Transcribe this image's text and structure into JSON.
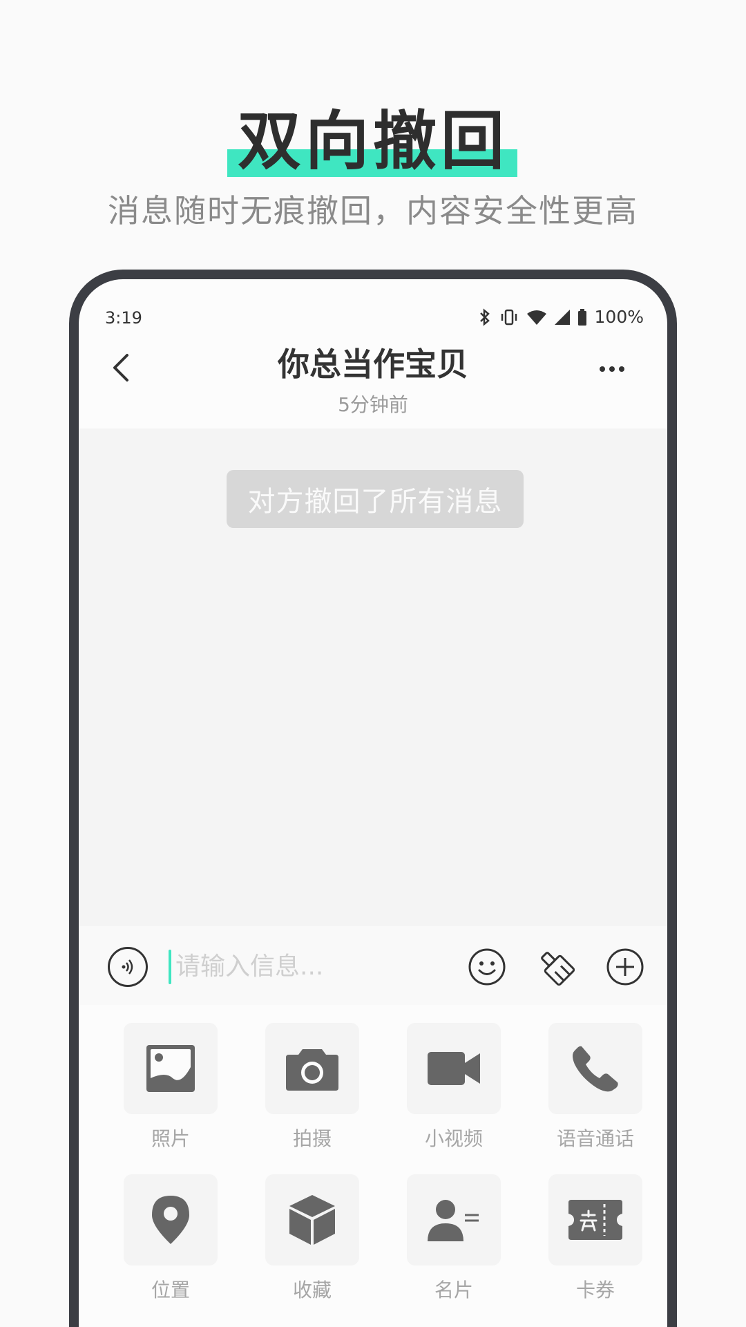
{
  "hero": {
    "title": "双向撤回",
    "subtitle": "消息随时无痕撤回，内容安全性更高"
  },
  "status_bar": {
    "time": "3:19",
    "battery": "100%"
  },
  "chat": {
    "title": "你总当作宝贝",
    "subtitle": "5分钟前",
    "system_message": "对方撤回了所有消息"
  },
  "input": {
    "placeholder": "请输入信息..."
  },
  "tools": [
    {
      "label": "照片",
      "icon": "photo-icon"
    },
    {
      "label": "拍摄",
      "icon": "camera-icon"
    },
    {
      "label": "小视频",
      "icon": "video-icon"
    },
    {
      "label": "语音通话",
      "icon": "phone-icon"
    },
    {
      "label": "位置",
      "icon": "location-pin-icon"
    },
    {
      "label": "收藏",
      "icon": "box-icon"
    },
    {
      "label": "名片",
      "icon": "contact-card-icon"
    },
    {
      "label": "卡券",
      "icon": "coupon-icon"
    }
  ],
  "colors": {
    "accent": "#3fe6c1",
    "frame": "#3c3e44",
    "icon": "#666666"
  }
}
